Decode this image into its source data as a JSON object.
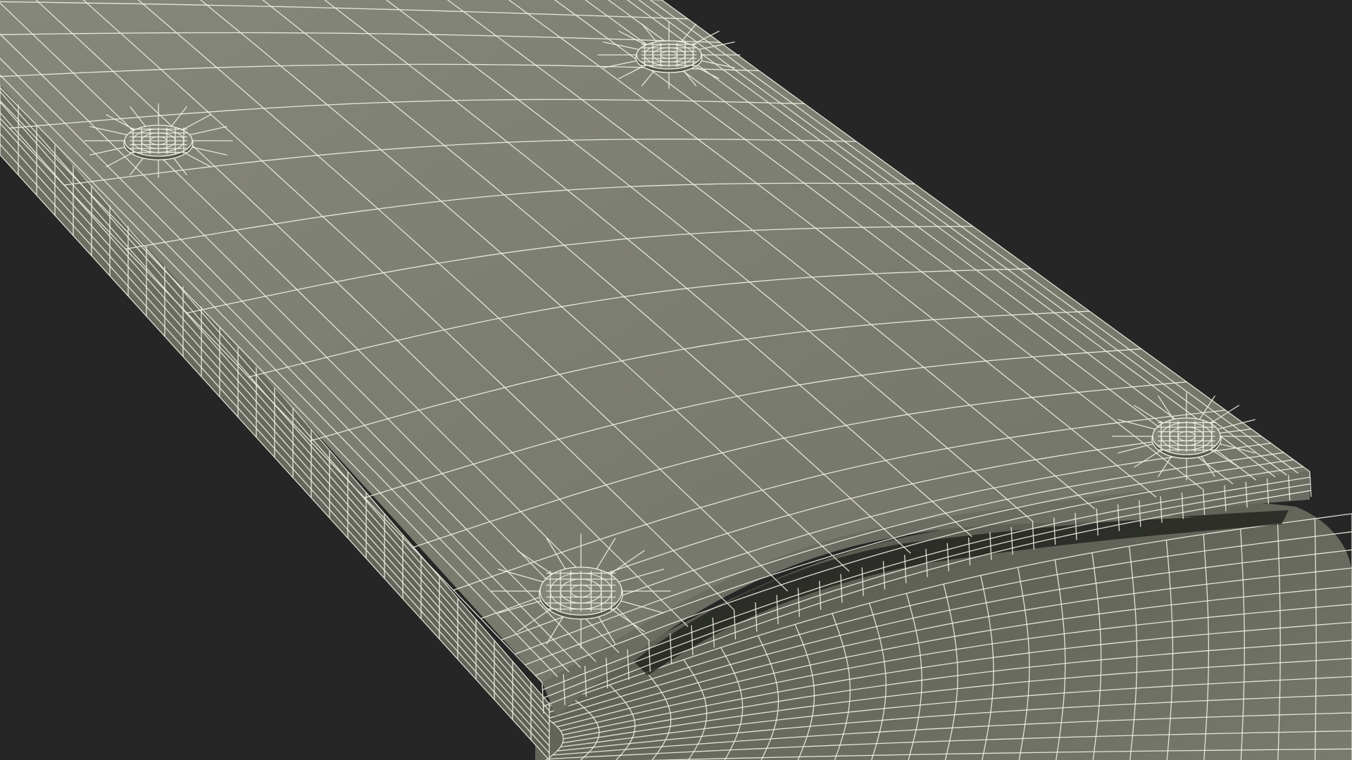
{
  "scene": {
    "subject": "wireframe-3d-model",
    "icon": "mesh-icon",
    "colors": {
      "background": "#262626",
      "surface": "#7a7b6f",
      "surface_light": "#85867a",
      "surface_shadow": "#55564c",
      "side": "#6c6d62",
      "shadow": "#1c1d1a",
      "wire": "#f2f1e6"
    }
  }
}
